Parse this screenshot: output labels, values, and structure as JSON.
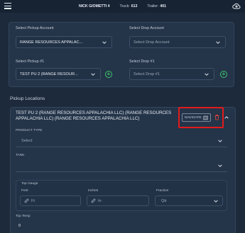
{
  "header": {
    "driver": "NICK GIOMETTI 4",
    "truck_label": "Truck:",
    "truck_value": "613",
    "trailer_label": "Trailer:",
    "trailer_value": "401"
  },
  "pickup_account": {
    "label": "Select Pickup Account",
    "value": "RANGE RESOURCES APPALAC..."
  },
  "drop_account": {
    "label": "Select Drop Account",
    "placeholder": "Select Drop Account"
  },
  "pickup": {
    "label": "Select Pickup #1",
    "value": "TEST PU 2 (RANGE RESOUR..."
  },
  "drop": {
    "label": "Select Drop #1",
    "placeholder": "Select Drop #1"
  },
  "pickup_locations": {
    "section_title": "Pickup Locations",
    "location_title_line1": "TEST PU 2 (RANGE RESOURCES APPALACHIA LLC) (RANGE RESOURCES",
    "location_title_line2": "APPALACHIA LLC) (RANGE RESOURCES APPALACHIA LLC)",
    "navigate_label": "NAVIGATE",
    "product_type_label": "PRODUCT TYPE",
    "product_type_placeholder": "Select",
    "tank_label": "TANK",
    "top_gauge_label": "Top Gauge",
    "feet_label": "Feet",
    "feet_placeholder": "Ft",
    "inches_label": "Inches",
    "inches_placeholder": "In",
    "fraction_label": "Fraction",
    "fraction_placeholder": "Qtr",
    "top_temp_label": "Top Temp",
    "top_temp_value": "0"
  },
  "colors": {
    "background": "#1d2a3b",
    "card": "#243449",
    "accent_green": "#3ec76b",
    "highlight_red": "#e21b1b",
    "delete_red": "#e0433a"
  },
  "icons": [
    "menu-icon",
    "cloud-upload-icon",
    "chevron-down-icon",
    "add-circle-icon",
    "map-icon",
    "trash-icon",
    "chevron-up-icon",
    "ruler-icon"
  ]
}
